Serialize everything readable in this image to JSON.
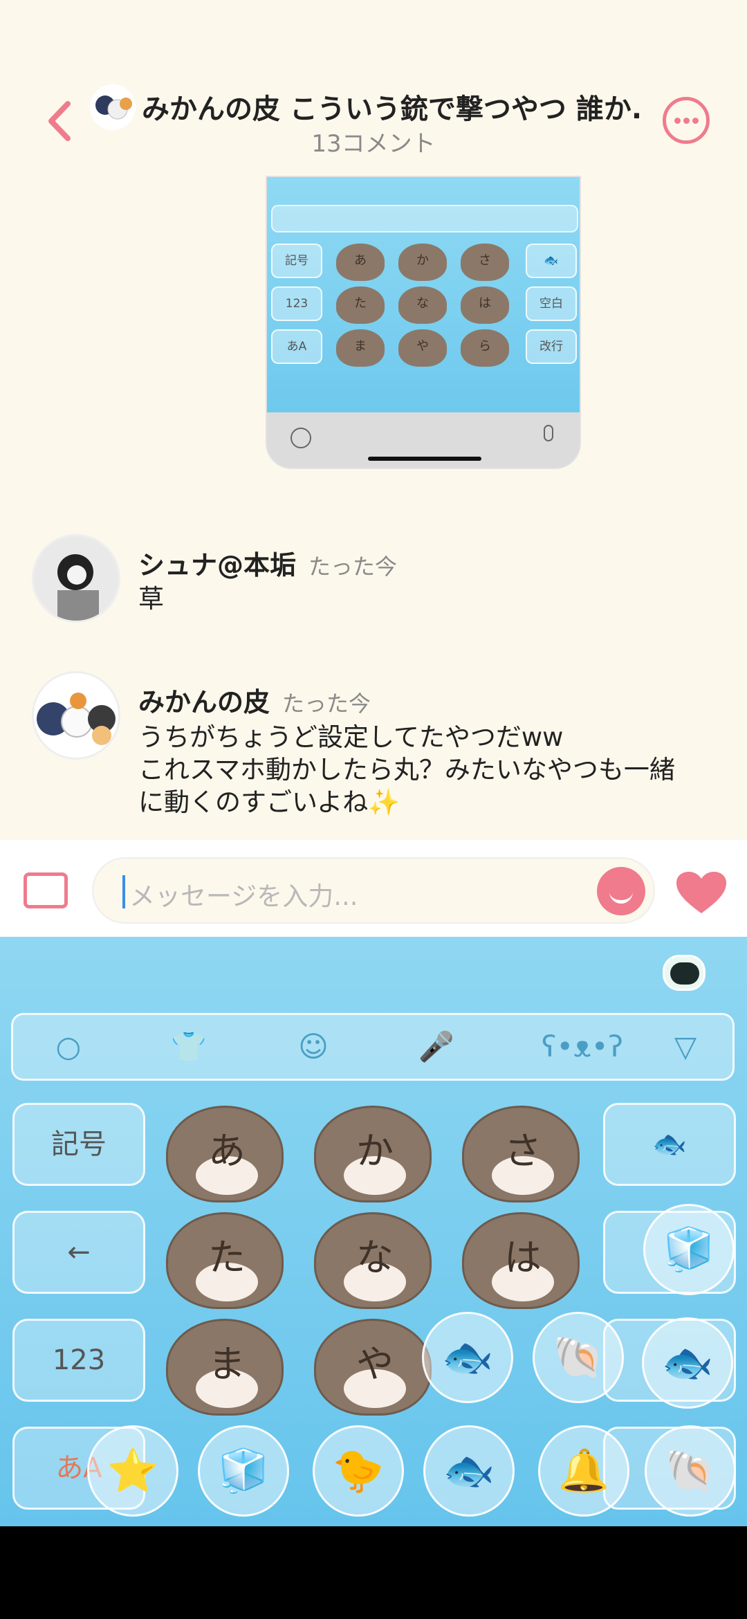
{
  "header": {
    "title": "みかんの皮 こういう銃で撃つやつ 誰か...",
    "subtitle": "13コメント"
  },
  "post_image": {
    "keys_left": [
      "記号",
      "123",
      "あA"
    ],
    "keys_right": [
      "空白",
      "改行"
    ],
    "otter_kana": [
      "あ",
      "か",
      "さ",
      "た",
      "な",
      "は",
      "ま",
      "や",
      "ら"
    ]
  },
  "comments": [
    {
      "name": "シュナ@本垢",
      "time": "たった今",
      "lines": [
        "草"
      ]
    },
    {
      "name": "みかんの皮",
      "time": "たった今",
      "lines": [
        "うちがちょうど設定してたやつだww",
        "これスマホ動かしたら丸？みたいなやつも一緒",
        "に動くのすごいよね✨"
      ]
    }
  ],
  "input": {
    "placeholder": "メッセージを入力..."
  },
  "keyboard": {
    "toolbar_icons": [
      "search-icon",
      "shirt-icon",
      "smiley-icon",
      "mic-icon",
      "bear-icon",
      "chevron-down-icon"
    ],
    "left_keys": [
      "記号",
      "←",
      "123",
      "あA"
    ],
    "otter_kana": [
      "あ",
      "か",
      "さ",
      "た",
      "な",
      "は",
      "ま",
      "や"
    ],
    "bubbles": [
      "⭐",
      "🐤",
      "🐟",
      "🔔",
      "🐚",
      "🐟"
    ]
  },
  "colors": {
    "accent": "#ef7b8d",
    "keyboard_bg": "#6ec9ee",
    "background": "#fdf8ec"
  }
}
